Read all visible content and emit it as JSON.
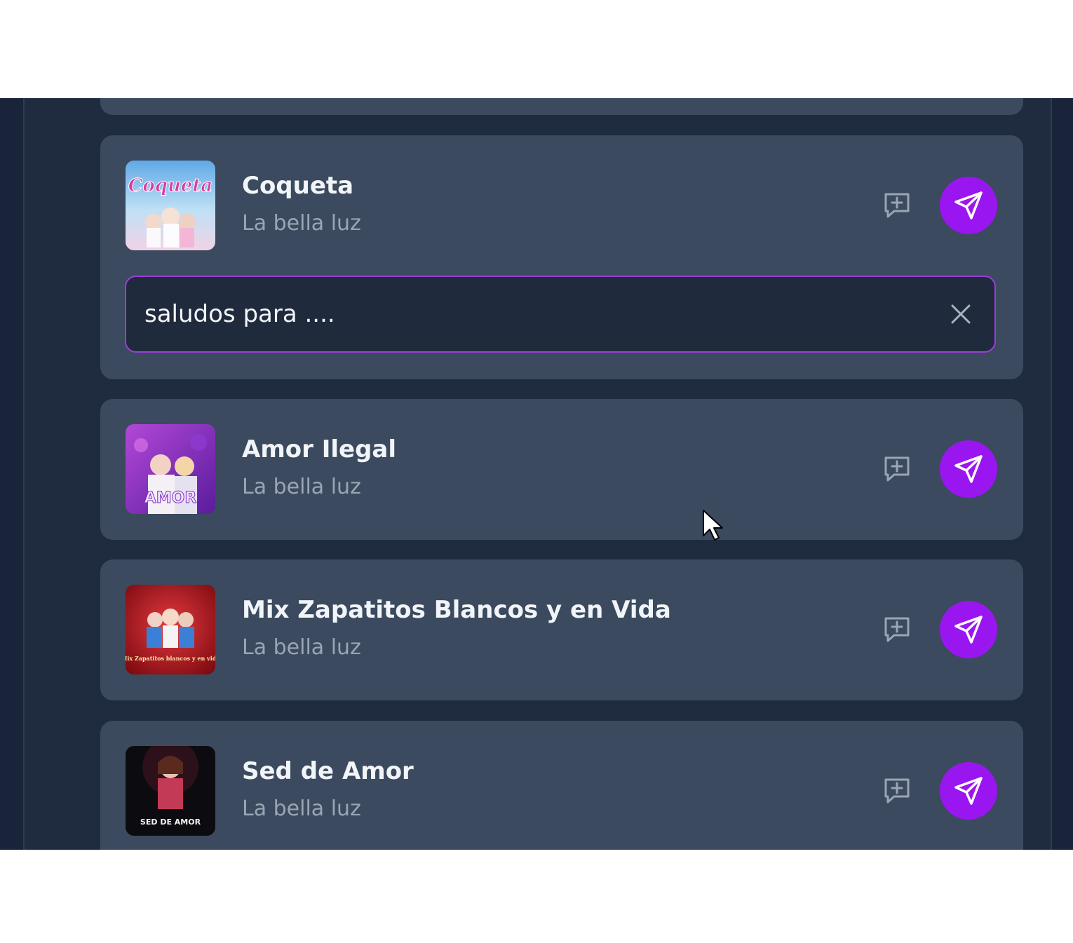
{
  "songs": [
    {
      "title": "Coqueta",
      "artist": "La bella luz",
      "cover_text": "Coqueta",
      "cover_palette": [
        "#6fb5e8",
        "#f3c7e2",
        "#d43da0"
      ],
      "expanded": true
    },
    {
      "title": "Amor Ilegal",
      "artist": "La bella luz",
      "cover_text": "AMOR",
      "cover_palette": [
        "#7a2fc4",
        "#c04fd9",
        "#f2e7f7"
      ],
      "expanded": false
    },
    {
      "title": "Mix Zapatitos Blancos y en Vida",
      "artist": "La bella luz",
      "cover_text": "Mix Zapatitos blancos y en vida",
      "cover_palette": [
        "#b3121b",
        "#e8454a",
        "#fbe7a6"
      ],
      "expanded": false
    },
    {
      "title": "Sed de Amor",
      "artist": "La bella luz",
      "cover_text": "SED DE AMOR",
      "cover_palette": [
        "#0c0c10",
        "#c23a55",
        "#f5f5f5"
      ],
      "expanded": false
    }
  ],
  "message_input": {
    "value": "saludos para ....",
    "border_color": "#9a3ddb"
  },
  "icons": {
    "add_message": "message-plus-icon",
    "send": "send-icon",
    "clear": "close-icon"
  },
  "colors": {
    "accent": "#9a16f0",
    "card": "#3b4a5e",
    "background": "#1f2c40"
  }
}
